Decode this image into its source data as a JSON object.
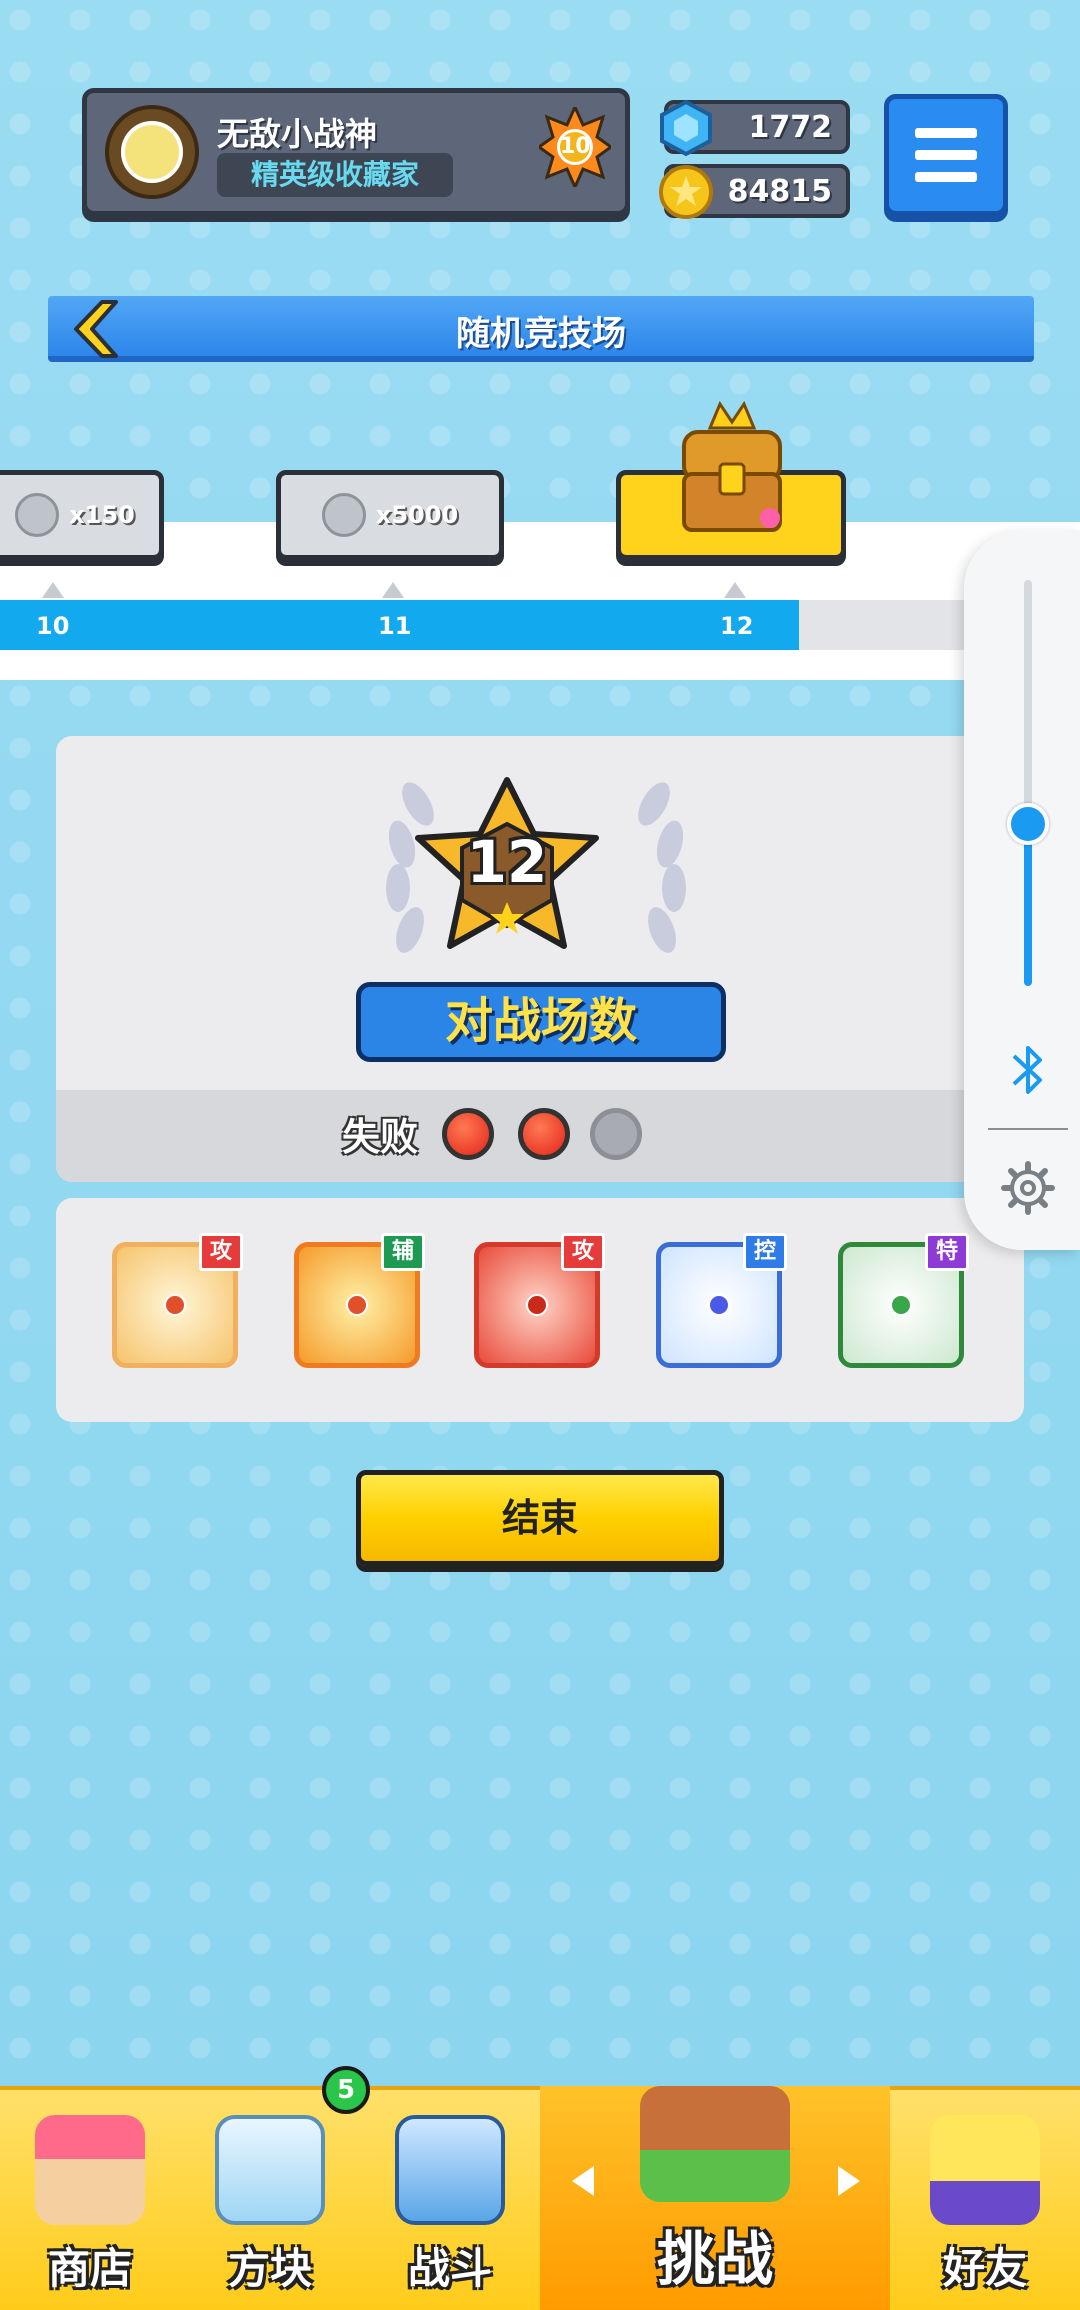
{
  "profile": {
    "name": "无敌小战神",
    "title": "精英级收藏家",
    "level": "10"
  },
  "currency": {
    "gems": "1772",
    "coins": "84815"
  },
  "header": {
    "title": "随机竞技场"
  },
  "track": {
    "rewards": [
      {
        "label": "x150",
        "icon": "gem-icon"
      },
      {
        "label": "x5000",
        "icon": "coin-icon"
      },
      {
        "label": "",
        "icon": "treasure-chest-icon"
      }
    ],
    "ticks": [
      "10",
      "11",
      "12"
    ],
    "progress_fraction": 0.74
  },
  "volume": {
    "level_fraction": 0.4
  },
  "stats": {
    "count": "12",
    "banner": "对战场数",
    "loss_label": "失败",
    "losses": [
      "lost",
      "lost",
      "empty"
    ]
  },
  "skills": [
    {
      "tag": "攻",
      "tag_color": "#e63b3b",
      "icon": "bow-icon"
    },
    {
      "tag": "辅",
      "tag_color": "#1f9a52",
      "icon": "sword-icon"
    },
    {
      "tag": "攻",
      "tag_color": "#e63b3b",
      "icon": "fire-icon"
    },
    {
      "tag": "控",
      "tag_color": "#2f7be8",
      "icon": "snowflake-icon"
    },
    {
      "tag": "特",
      "tag_color": "#8e3bd6",
      "icon": "plant-icon"
    }
  ],
  "end_button": "结束",
  "nav": {
    "items": [
      {
        "label": "商店",
        "icon": "shop-icon"
      },
      {
        "label": "方块",
        "icon": "block-icon",
        "badge": "5"
      },
      {
        "label": "战斗",
        "icon": "battle-icon"
      },
      {
        "label": "挑战",
        "icon": "challenge-icon"
      },
      {
        "label": "好友",
        "icon": "friends-icon"
      }
    ]
  },
  "colors": {
    "accent_blue": "#2d86ea",
    "gold": "#ffd21c",
    "loss_red": "#e3231a"
  }
}
